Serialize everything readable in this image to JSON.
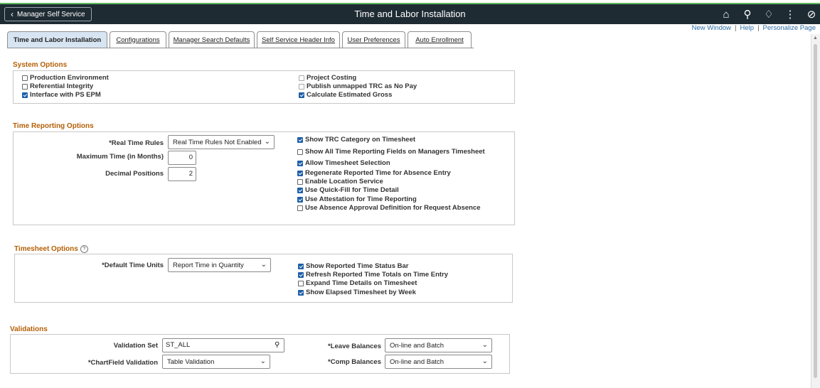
{
  "header": {
    "back_label": "Manager Self Service",
    "title": "Time and Labor Installation",
    "icons": [
      "home-icon",
      "search-icon",
      "bell-icon",
      "more-icon",
      "compass-icon"
    ]
  },
  "links": {
    "new_window": "New Window",
    "help": "Help",
    "personalize": "Personalize Page"
  },
  "tabs": [
    "Time and Labor Installation",
    "Configurations",
    "Manager Search Defaults",
    "Self Service Header Info",
    "User Preferences",
    "Auto Enrollment"
  ],
  "system_options": {
    "title": "System Options",
    "left": [
      {
        "label": "Production Environment",
        "checked": false
      },
      {
        "label": "Referential Integrity",
        "checked": false
      },
      {
        "label": "Interface with PS EPM",
        "checked": true
      }
    ],
    "right": [
      {
        "label": "Project Costing",
        "checked": false,
        "disabled": true
      },
      {
        "label": "Publish unmapped TRC as No Pay",
        "checked": false,
        "disabled": true
      },
      {
        "label": "Calculate Estimated Gross",
        "checked": true,
        "disabled": false
      }
    ]
  },
  "time_reporting": {
    "title": "Time Reporting Options",
    "real_time_rules_label": "*Real Time Rules",
    "real_time_rules_value": "Real Time Rules Not Enabled",
    "max_time_label": "Maximum Time (in Months)",
    "max_time_value": "0",
    "decimal_label": "Decimal Positions",
    "decimal_value": "2",
    "options": [
      {
        "label": "Show TRC Category on Timesheet",
        "checked": true
      },
      {
        "label": "Show All Time Reporting Fields on Managers Timesheet",
        "checked": false
      },
      {
        "label": "Allow Timesheet Selection",
        "checked": true
      },
      {
        "label": "Regenerate Reported Time for Absence Entry",
        "checked": true
      },
      {
        "label": "Enable Location Service",
        "checked": false
      },
      {
        "label": "Use Quick-Fill for Time Detail",
        "checked": true
      },
      {
        "label": "Use Attestation for Time Reporting",
        "checked": true
      },
      {
        "label": "Use Absence Approval Definition for Request Absence",
        "checked": false
      }
    ]
  },
  "timesheet": {
    "title": "Timesheet Options",
    "default_units_label": "*Default Time Units",
    "default_units_value": "Report Time in Quantity",
    "options": [
      {
        "label": "Show Reported Time Status Bar",
        "checked": true
      },
      {
        "label": "Refresh Reported Time Totals on Time Entry",
        "checked": true
      },
      {
        "label": "Expand Time Details on Timesheet",
        "checked": false
      },
      {
        "label": "Show Elapsed Timesheet by Week",
        "checked": true
      }
    ]
  },
  "validations": {
    "title": "Validations",
    "validation_set_label": "Validation Set",
    "validation_set_value": "ST_ALL",
    "chartfield_label": "*ChartField Validation",
    "chartfield_value": "Table Validation",
    "leave_label": "*Leave Balances",
    "leave_value": "On-line and Batch",
    "comp_label": "*Comp Balances",
    "comp_value": "On-line and Batch"
  }
}
